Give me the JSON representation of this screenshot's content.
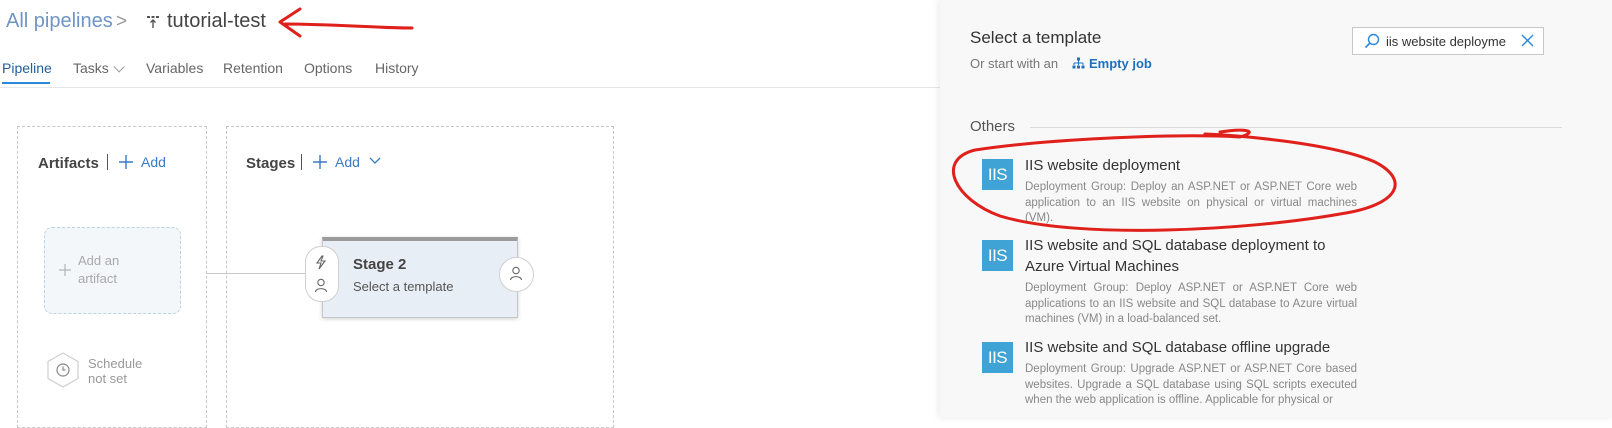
{
  "header": {
    "breadcrumb_root": "All pipelines",
    "breadcrumb_separator": ">",
    "pipeline_name": "tutorial-test"
  },
  "tabs": [
    {
      "label": "Pipeline",
      "active": true
    },
    {
      "label": "Tasks",
      "active": false
    },
    {
      "label": "Variables",
      "active": false
    },
    {
      "label": "Retention",
      "active": false
    },
    {
      "label": "Options",
      "active": false
    },
    {
      "label": "History",
      "active": false
    }
  ],
  "artifacts": {
    "title": "Artifacts",
    "add_label": "Add",
    "placeholder_line1": "Add an",
    "placeholder_line2": "artifact",
    "schedule_line1": "Schedule",
    "schedule_line2": "not set"
  },
  "stages": {
    "title": "Stages",
    "add_label": "Add",
    "stage_name": "Stage 2",
    "stage_subtitle": "Select a template"
  },
  "template_panel": {
    "title": "Select a template",
    "or_text": "Or start with an",
    "empty_job_label": "Empty job",
    "search_value": "iis website deployme",
    "section": "Others",
    "templates": [
      {
        "icon_text": "IIS",
        "name": "IIS website deployment",
        "description": "Deployment Group: Deploy an ASP.NET or ASP.NET Core web application to an IIS website on physical or virtual machines (VM)."
      },
      {
        "icon_text": "IIS",
        "name": "IIS website and SQL database deployment to Azure Virtual Machines",
        "description": "Deployment Group: Deploy ASP.NET or ASP.NET Core web applications to an IIS website and SQL database to Azure virtual machines (VM) in a load-balanced set."
      },
      {
        "icon_text": "IIS",
        "name": "IIS website and SQL database offline upgrade",
        "description": "Deployment Group: Upgrade ASP.NET or ASP.NET Core based websites. Upgrade a SQL database using SQL scripts executed when the web application is offline. Applicable for physical or"
      }
    ]
  },
  "colors": {
    "accent": "#2b88d8",
    "link": "#3a7ac2",
    "iis_tile": "#3fa3d6",
    "annotation": "#e0201b"
  },
  "icons": [
    "pipeline-icon",
    "chevron-down-icon",
    "plus-icon",
    "lightning-icon",
    "person-icon",
    "clock-icon",
    "search-icon",
    "close-icon",
    "empty-job-icon"
  ]
}
